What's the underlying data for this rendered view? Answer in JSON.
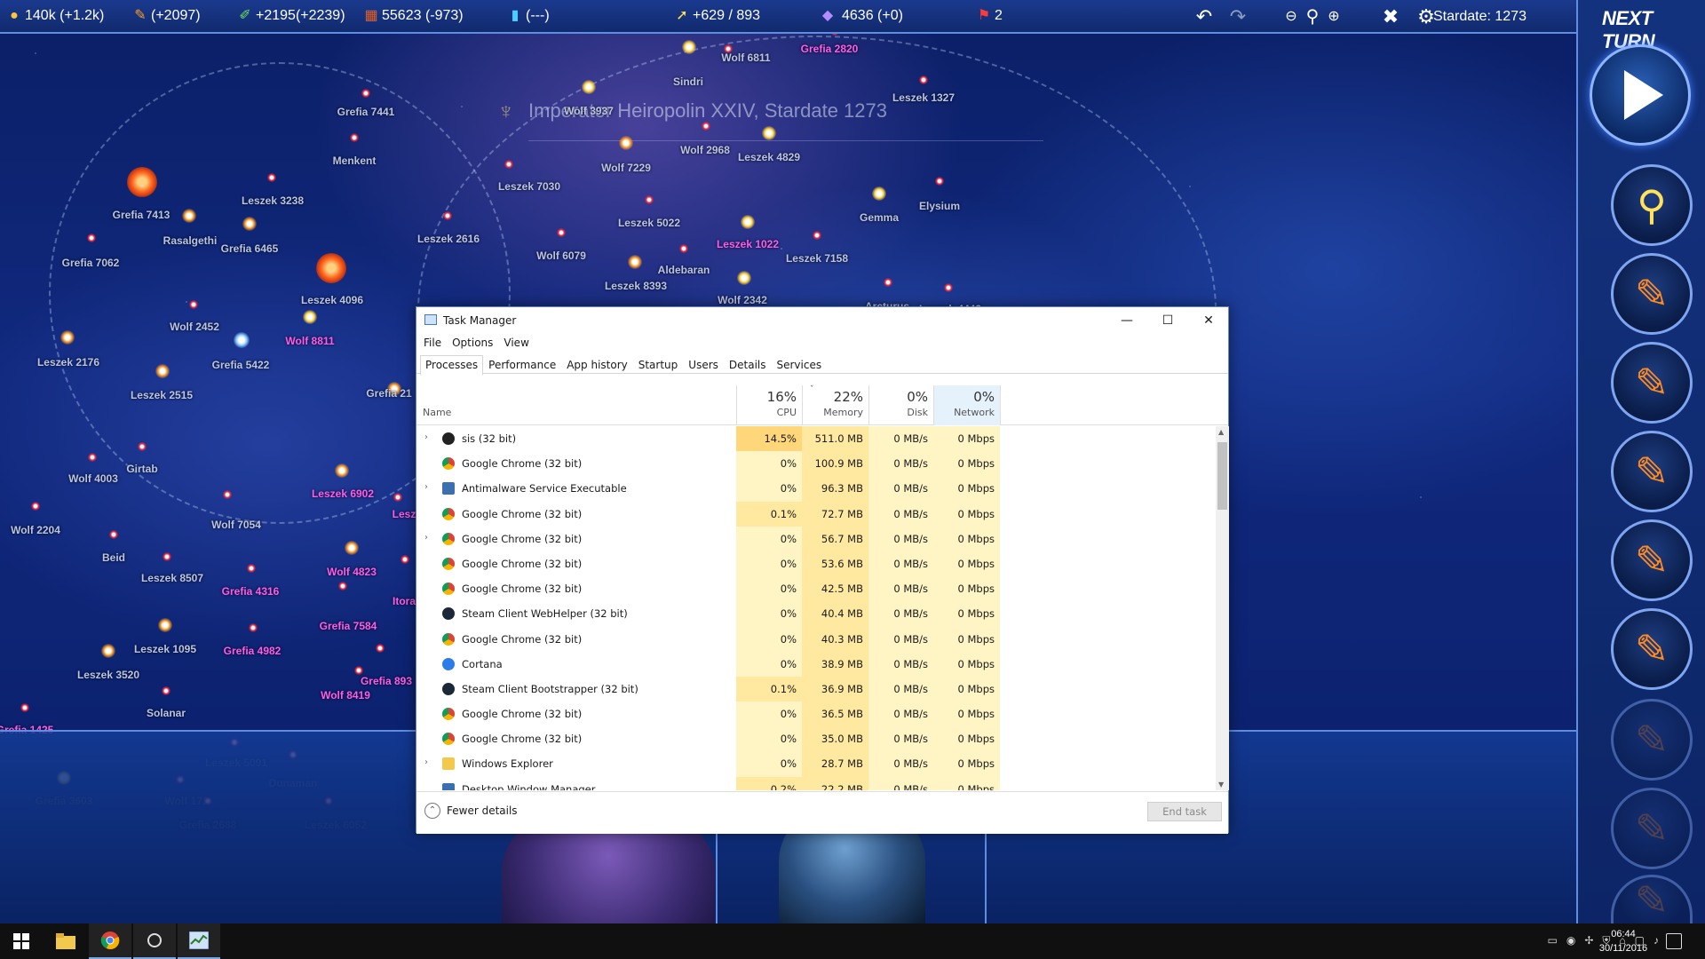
{
  "topbar": {
    "resources": [
      {
        "name": "credits",
        "icon": "coin-icon",
        "value": "140k (+1.2k)"
      },
      {
        "name": "industry",
        "icon": "wrench-icon",
        "value": "(+2097)"
      },
      {
        "name": "research",
        "icon": "flask-icon",
        "value": "+2195(+2239)"
      },
      {
        "name": "population",
        "icon": "bricks-icon",
        "value": "55623 (-973)"
      },
      {
        "name": "energy",
        "icon": "vial-icon",
        "value": "(---)"
      },
      {
        "name": "fleet",
        "icon": "ship-icon",
        "value": "+629 / 893"
      },
      {
        "name": "diplomacy",
        "icon": "handshake-icon",
        "value": "4636 (+0)"
      },
      {
        "name": "alerts",
        "icon": "flag-icon",
        "value": "2"
      }
    ],
    "stardate": "Stardate: 1273",
    "next_turn_label": "NEXT TURN"
  },
  "map": {
    "empire_banner": "Imperator Heiropolin XXIV, Stardate 1273",
    "systems": [
      {
        "name": "Wolf 6811",
        "owned": false
      },
      {
        "name": "Grefia 2820",
        "owned": true
      },
      {
        "name": "Sindri",
        "owned": false
      },
      {
        "name": "Leszek 1327",
        "owned": false
      },
      {
        "name": "Grefia 7441",
        "owned": false
      },
      {
        "name": "Wolf 3937",
        "owned": false
      },
      {
        "name": "Menkent",
        "owned": false
      },
      {
        "name": "Wolf 2968",
        "owned": false
      },
      {
        "name": "Leszek 4829",
        "owned": false
      },
      {
        "name": "Wolf 7229",
        "owned": false
      },
      {
        "name": "Leszek 3238",
        "owned": false
      },
      {
        "name": "Leszek 7030",
        "owned": false
      },
      {
        "name": "Grefia 7413",
        "owned": false
      },
      {
        "name": "Elysium",
        "owned": false
      },
      {
        "name": "Gemma",
        "owned": false
      },
      {
        "name": "Rasalgethi",
        "owned": false
      },
      {
        "name": "Leszek 5022",
        "owned": false
      },
      {
        "name": "Grefia 6465",
        "owned": false
      },
      {
        "name": "Leszek 2616",
        "owned": false
      },
      {
        "name": "Wolf 6079",
        "owned": false
      },
      {
        "name": "Leszek 1022",
        "owned": true
      },
      {
        "name": "Leszek 7158",
        "owned": false
      },
      {
        "name": "Grefia 7062",
        "owned": false
      },
      {
        "name": "Aldebaran",
        "owned": false
      },
      {
        "name": "Leszek 8393",
        "owned": false
      },
      {
        "name": "Leszek 4096",
        "owned": false
      },
      {
        "name": "Wolf 2342",
        "owned": false
      },
      {
        "name": "Arcturus",
        "owned": false
      },
      {
        "name": "Leszek 4448",
        "owned": false
      },
      {
        "name": "Wolf 2452",
        "owned": false
      },
      {
        "name": "Wolf 8811",
        "owned": true
      },
      {
        "name": "Leszek 2176",
        "owned": false
      },
      {
        "name": "Grefia 5422",
        "owned": false
      },
      {
        "name": "Leszek 2515",
        "owned": false
      },
      {
        "name": "Grefia 21",
        "owned": false
      },
      {
        "name": "Girtab",
        "owned": false
      },
      {
        "name": "Wolf 4003",
        "owned": false
      },
      {
        "name": "Leszek 6902",
        "owned": true
      },
      {
        "name": "Lesz",
        "owned": true
      },
      {
        "name": "Wolf 7054",
        "owned": false
      },
      {
        "name": "Wolf 2204",
        "owned": false
      },
      {
        "name": "Beid",
        "owned": false
      },
      {
        "name": "Wolf 4823",
        "owned": true
      },
      {
        "name": "Leszek 8507",
        "owned": false
      },
      {
        "name": "Grefia 4316",
        "owned": true
      },
      {
        "name": "Itora",
        "owned": true
      },
      {
        "name": "Grefia 7584",
        "owned": true
      },
      {
        "name": "Leszek 1095",
        "owned": false
      },
      {
        "name": "Grefia 4982",
        "owned": true
      },
      {
        "name": "Leszek 3520",
        "owned": false
      },
      {
        "name": "Grefia 893",
        "owned": true
      },
      {
        "name": "Wolf 8419",
        "owned": true
      },
      {
        "name": "Solanar",
        "owned": false
      },
      {
        "name": "Grefia 1425",
        "owned": true
      },
      {
        "name": "Leszek 5091",
        "owned": false
      },
      {
        "name": "Dunaman",
        "owned": false
      },
      {
        "name": "Grefia 3603",
        "owned": false
      },
      {
        "name": "Wolf 171",
        "owned": false
      },
      {
        "name": "Grefia 2688",
        "owned": false
      },
      {
        "name": "Leszek 6052",
        "owned": false
      }
    ]
  },
  "taskmgr": {
    "title": "Task Manager",
    "window_controls": {
      "minimize": "—",
      "maximize": "☐",
      "close": "✕"
    },
    "menu": [
      "File",
      "Options",
      "View"
    ],
    "tabs": [
      "Processes",
      "Performance",
      "App history",
      "Startup",
      "Users",
      "Details",
      "Services"
    ],
    "active_tab": "Processes",
    "columns": {
      "name": "Name",
      "cpu": {
        "pct": "16%",
        "label": "CPU"
      },
      "memory": {
        "pct": "22%",
        "label": "Memory"
      },
      "disk": {
        "pct": "0%",
        "label": "Disk"
      },
      "network": {
        "pct": "0%",
        "label": "Network"
      }
    },
    "processes": [
      {
        "name": "sis (32 bit)",
        "icon": "sis-icon",
        "expand": true,
        "cpu": "14.5%",
        "memory": "511.0 MB",
        "disk": "0 MB/s",
        "network": "0 Mbps",
        "cpu_level": 2
      },
      {
        "name": "Google Chrome (32 bit)",
        "icon": "chrome-icon",
        "expand": false,
        "cpu": "0%",
        "memory": "100.9 MB",
        "disk": "0 MB/s",
        "network": "0 Mbps",
        "cpu_level": 0
      },
      {
        "name": "Antimalware Service Executable",
        "icon": "window-icon",
        "expand": true,
        "cpu": "0%",
        "memory": "96.3 MB",
        "disk": "0 MB/s",
        "network": "0 Mbps",
        "cpu_level": 0
      },
      {
        "name": "Google Chrome (32 bit)",
        "icon": "chrome-icon",
        "expand": false,
        "cpu": "0.1%",
        "memory": "72.7 MB",
        "disk": "0 MB/s",
        "network": "0 Mbps",
        "cpu_level": 1
      },
      {
        "name": "Google Chrome (32 bit)",
        "icon": "chrome-icon",
        "expand": true,
        "cpu": "0%",
        "memory": "56.7 MB",
        "disk": "0 MB/s",
        "network": "0 Mbps",
        "cpu_level": 0
      },
      {
        "name": "Google Chrome (32 bit)",
        "icon": "chrome-icon",
        "expand": false,
        "cpu": "0%",
        "memory": "53.6 MB",
        "disk": "0 MB/s",
        "network": "0 Mbps",
        "cpu_level": 0
      },
      {
        "name": "Google Chrome (32 bit)",
        "icon": "chrome-icon",
        "expand": false,
        "cpu": "0%",
        "memory": "42.5 MB",
        "disk": "0 MB/s",
        "network": "0 Mbps",
        "cpu_level": 0
      },
      {
        "name": "Steam Client WebHelper (32 bit)",
        "icon": "steam-icon",
        "expand": false,
        "cpu": "0%",
        "memory": "40.4 MB",
        "disk": "0 MB/s",
        "network": "0 Mbps",
        "cpu_level": 0
      },
      {
        "name": "Google Chrome (32 bit)",
        "icon": "chrome-icon",
        "expand": false,
        "cpu": "0%",
        "memory": "40.3 MB",
        "disk": "0 MB/s",
        "network": "0 Mbps",
        "cpu_level": 0
      },
      {
        "name": "Cortana",
        "icon": "cortana-icon",
        "expand": false,
        "cpu": "0%",
        "memory": "38.9 MB",
        "disk": "0 MB/s",
        "network": "0 Mbps",
        "cpu_level": 0
      },
      {
        "name": "Steam Client Bootstrapper (32 bit)",
        "icon": "steam-icon",
        "expand": false,
        "cpu": "0.1%",
        "memory": "36.9 MB",
        "disk": "0 MB/s",
        "network": "0 Mbps",
        "cpu_level": 1
      },
      {
        "name": "Google Chrome (32 bit)",
        "icon": "chrome-icon",
        "expand": false,
        "cpu": "0%",
        "memory": "36.5 MB",
        "disk": "0 MB/s",
        "network": "0 Mbps",
        "cpu_level": 0
      },
      {
        "name": "Google Chrome (32 bit)",
        "icon": "chrome-icon",
        "expand": false,
        "cpu": "0%",
        "memory": "35.0 MB",
        "disk": "0 MB/s",
        "network": "0 Mbps",
        "cpu_level": 0
      },
      {
        "name": "Windows Explorer",
        "icon": "folder-icon",
        "expand": true,
        "cpu": "0%",
        "memory": "28.7 MB",
        "disk": "0 MB/s",
        "network": "0 Mbps",
        "cpu_level": 0
      },
      {
        "name": "Desktop Window Manager",
        "icon": "window-icon",
        "expand": false,
        "cpu": "0.2%",
        "memory": "22.2 MB",
        "disk": "0 MB/s",
        "network": "0 Mbps",
        "cpu_level": 1
      }
    ],
    "footer": {
      "fewer_details": "Fewer details",
      "end_task": "End task"
    }
  },
  "taskbar": {
    "apps": [
      {
        "name": "start-button",
        "icon": "windows-icon"
      },
      {
        "name": "file-explorer",
        "icon": "folder-icon"
      },
      {
        "name": "chrome",
        "icon": "chrome-icon"
      },
      {
        "name": "sis-game",
        "icon": "sis-icon"
      },
      {
        "name": "task-manager",
        "icon": "taskmgr-icon"
      }
    ],
    "clock_time": "06:44",
    "clock_date": "30/11/2016"
  },
  "colors": {
    "game_bg": "#11297e",
    "owned_system": "#ff5cf0",
    "accent": "#5f8ee0",
    "cpu_highlight": "#ffd77a",
    "net_header": "#e5f1fb"
  }
}
